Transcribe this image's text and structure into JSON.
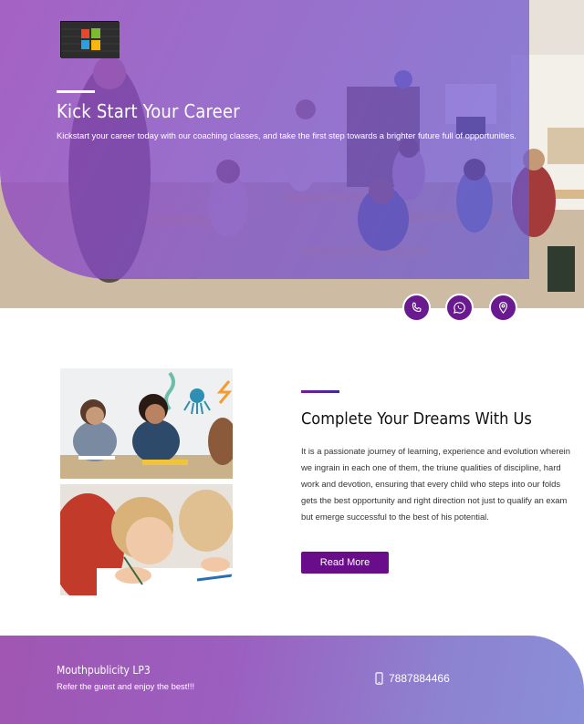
{
  "hero": {
    "title": "Kick Start Your Career",
    "subtitle": "Kickstart your career today with our coaching classes, and take the first step towards a brighter future full of opportunities.",
    "contact_icons": [
      "phone-icon",
      "whatsapp-icon",
      "location-pin-icon"
    ]
  },
  "about": {
    "title": "Complete Your Dreams With Us",
    "paragraph": "It is a passionate journey of learning, experience and evolution wherein we ingrain in each one of them, the triune qualities of discipline, hard work and devotion, ensuring that every child who steps into our folds gets the best opportunity and right direction not just to qualify an exam but emerge successful to the best of his potential.",
    "button_label": "Read More"
  },
  "footer": {
    "brand": "Mouthpublicity LP3",
    "tagline": "Refer the guest and enjoy the best!!!",
    "phone": "7887884466"
  },
  "colors": {
    "accent": "#6a0d8a",
    "overlay_start": "#9646be",
    "overlay_end": "#645ad2",
    "footer_start": "#a056b2",
    "footer_end": "#8a8fd8"
  }
}
